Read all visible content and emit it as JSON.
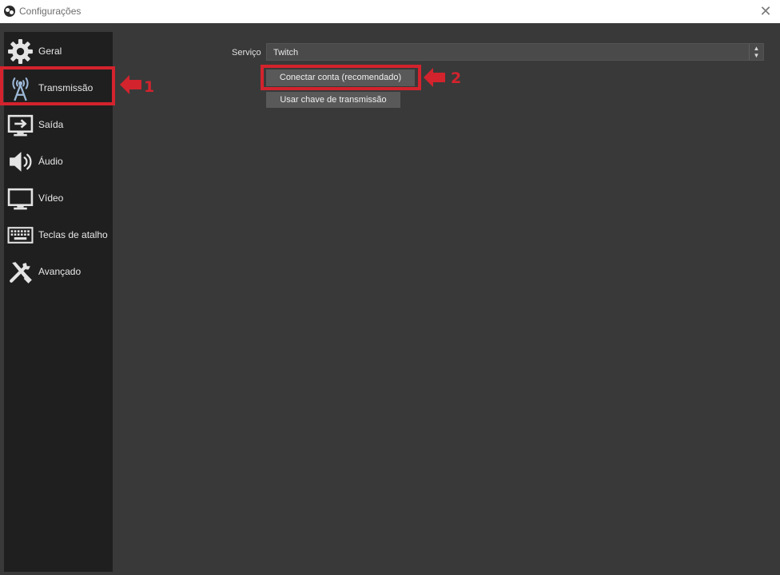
{
  "window": {
    "title": "Configurações",
    "close_glyph": "✕"
  },
  "sidebar": {
    "items": [
      {
        "label": "Geral",
        "icon": "gear-icon"
      },
      {
        "label": "Transmissão",
        "icon": "antenna-icon"
      },
      {
        "label": "Saída",
        "icon": "output-icon"
      },
      {
        "label": "Áudio",
        "icon": "speaker-icon"
      },
      {
        "label": "Vídeo",
        "icon": "monitor-icon"
      },
      {
        "label": "Teclas de atalho",
        "icon": "keyboard-icon"
      },
      {
        "label": "Avançado",
        "icon": "tools-icon"
      }
    ],
    "selected": "Transmissão"
  },
  "main": {
    "service_label": "Serviço",
    "service_value": "Twitch",
    "connect_button": "Conectar conta (recomendado)",
    "stream_key_button": "Usar chave de transmissão"
  },
  "annotations": {
    "step1": "1",
    "step2": "2",
    "color": "#d3232d"
  }
}
